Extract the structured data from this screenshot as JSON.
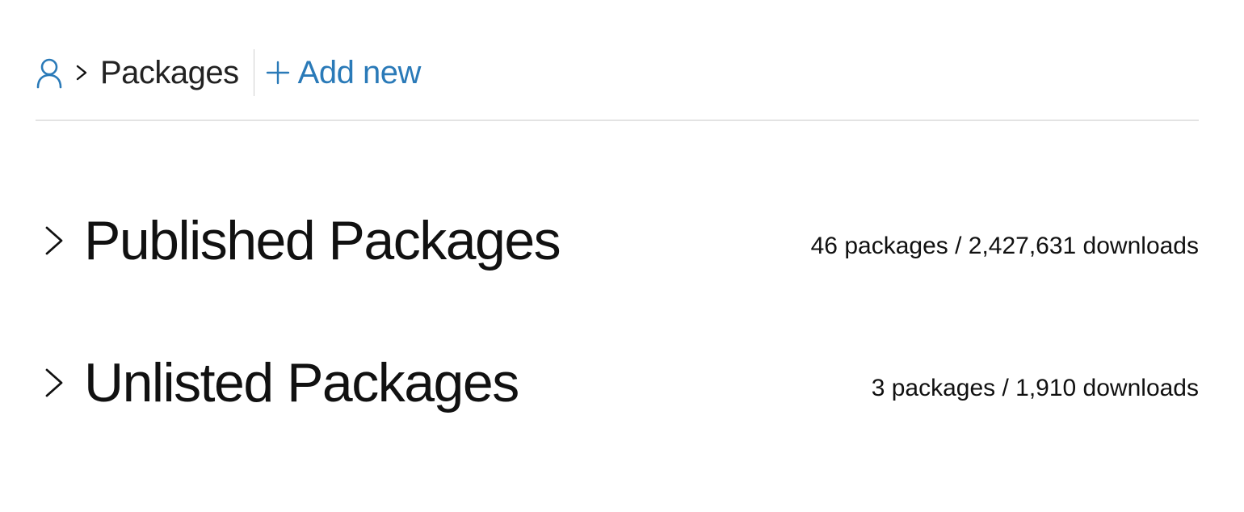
{
  "breadcrumb": {
    "user_icon": "user-icon",
    "separator_icon": "chevron-right-icon",
    "title": "Packages",
    "add_new_icon": "plus-icon",
    "add_new_label": "Add new"
  },
  "sections": [
    {
      "icon": "chevron-right-icon",
      "title": "Published Packages",
      "stats": "46 packages / 2,427,631 downloads"
    },
    {
      "icon": "chevron-right-icon",
      "title": "Unlisted Packages",
      "stats": "3 packages / 1,910 downloads"
    }
  ],
  "colors": {
    "accent": "#2a7ab8",
    "text": "#111111",
    "divider": "#e3e3e3"
  }
}
